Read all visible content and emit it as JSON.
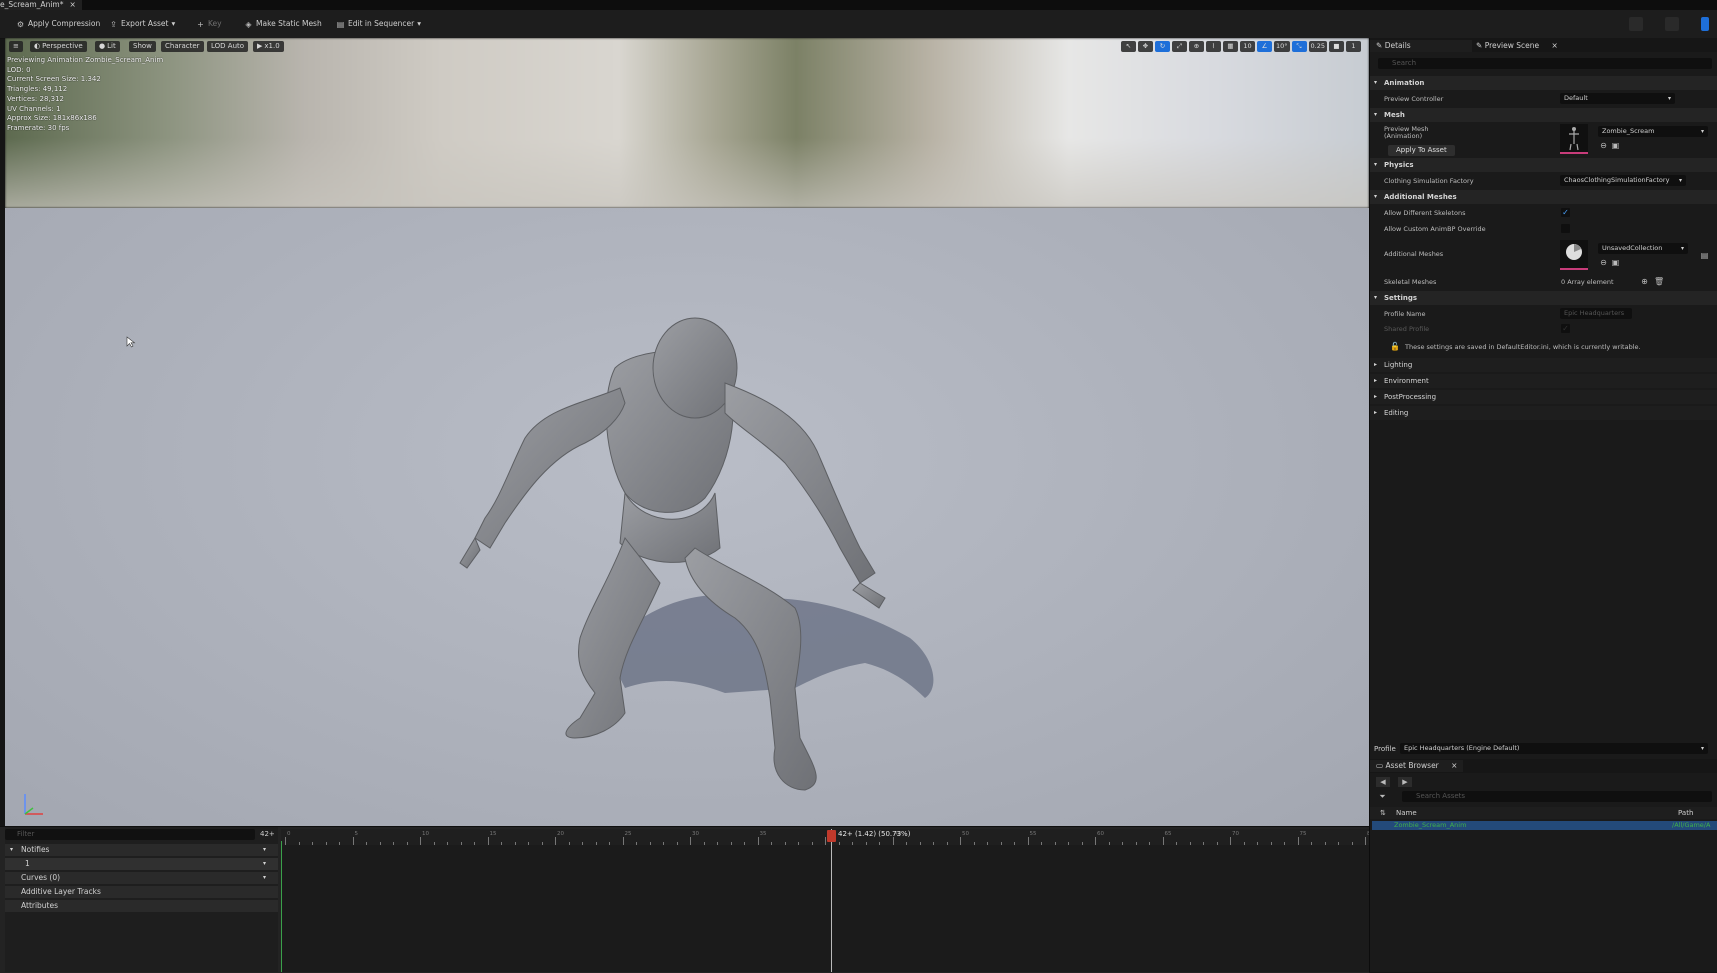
{
  "document_tab": {
    "label": "e_Scream_Anim*",
    "close": "×"
  },
  "toolbar": {
    "apply_compression": "Apply Compression",
    "export_asset": "Export Asset",
    "key": "Key",
    "make_static_mesh": "Make Static Mesh",
    "edit_in_sequencer": "Edit in Sequencer"
  },
  "viewport": {
    "menu": "≡",
    "perspective": "Perspective",
    "lit": "Lit",
    "show": "Show",
    "character": "Character",
    "lod": "LOD Auto",
    "speed": "x1.0",
    "right_toolbar": [
      "10",
      "10°",
      "0.25",
      "1"
    ],
    "stats": [
      "Previewing Animation Zombie_Scream_Anim",
      "LOD: 0",
      "Current Screen Size: 1.342",
      "Triangles: 49,112",
      "Vertices: 28,312",
      "UV Channels: 1",
      "Approx Size: 181x86x186",
      "Framerate: 30 fps"
    ]
  },
  "timeline": {
    "filter_placeholder": "Filter",
    "frame_count": "42+",
    "scrub_label": "42+ (1.42) (50.73%)",
    "rows": [
      "Notifies",
      "1",
      "Curves (0)",
      "Additive Layer Tracks",
      "Attributes"
    ],
    "ticks": [
      "0",
      "5",
      "10",
      "15",
      "20",
      "25",
      "30",
      "35",
      "40",
      "45",
      "50",
      "55",
      "60",
      "65",
      "70",
      "75",
      "80"
    ],
    "scrub_fraction": 0.51
  },
  "right_panel": {
    "tab_details": "Details",
    "tab_preview_scene": "Preview Scene",
    "tab_close": "×",
    "search_placeholder": "Search",
    "cat_animation": "Animation",
    "preview_controller_label": "Preview Controller",
    "preview_controller_value": "Default",
    "cat_mesh": "Mesh",
    "preview_mesh_label": "Preview Mesh (Animation)",
    "preview_mesh_value": "Zombie_Scream",
    "apply_to_asset": "Apply To Asset",
    "cat_physics": "Physics",
    "clothing_label": "Clothing Simulation Factory",
    "clothing_value": "ChaosClothingSimulationFactory",
    "cat_additional_meshes": "Additional Meshes",
    "allow_diff_skeletons": "Allow Different Skeletons",
    "allow_custom_animbp": "Allow Custom AnimBP Override",
    "additional_meshes_label": "Additional Meshes",
    "additional_meshes_value": "UnsavedCollection",
    "skeletal_meshes_label": "Skeletal Meshes",
    "skeletal_meshes_value": "0 Array element",
    "cat_settings": "Settings",
    "profile_name_label": "Profile Name",
    "profile_name_value": "Epic Headquarters",
    "shared_profile_label": "Shared Profile",
    "settings_note": "These settings are saved in DefaultEditor.ini, which is currently writable.",
    "cat_lighting": "Lighting",
    "cat_environment": "Environment",
    "cat_postprocessing": "PostProcessing",
    "cat_editing": "Editing",
    "profile_label": "Profile",
    "profile_value": "Epic Headquarters (Engine Default)",
    "asset_browser_tab": "Asset Browser",
    "search_assets_placeholder": "Search Assets",
    "col_name": "Name",
    "col_path": "Path",
    "asset_name": "Zombie_Scream_Anim",
    "asset_path": "/All/Game/A"
  },
  "colors": {
    "accent": "#1e6fd9",
    "scrub": "#c0392b",
    "selection": "#234a7a"
  }
}
